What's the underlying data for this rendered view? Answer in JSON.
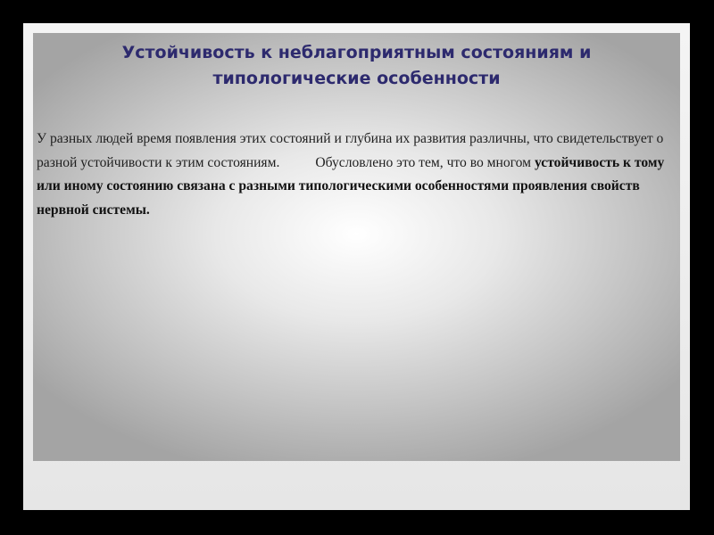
{
  "slide": {
    "title_line1": "Устойчивость к неблагоприятным состояниям и",
    "title_line2": "типологические особенности",
    "body": {
      "part1": " У разных людей время появления этих состояний и глубина их развития различны, что свидетельствует о разной устойчивости к этим состояниям.",
      "part2": "Обусловлено это тем, что во многом ",
      "part3_bold": "устойчивость к тому или иному состоянию связана с разными типологическими особенностями проявления свойств нервной системы."
    }
  },
  "colors": {
    "title": "#2d2a6e",
    "background": "#000000"
  }
}
